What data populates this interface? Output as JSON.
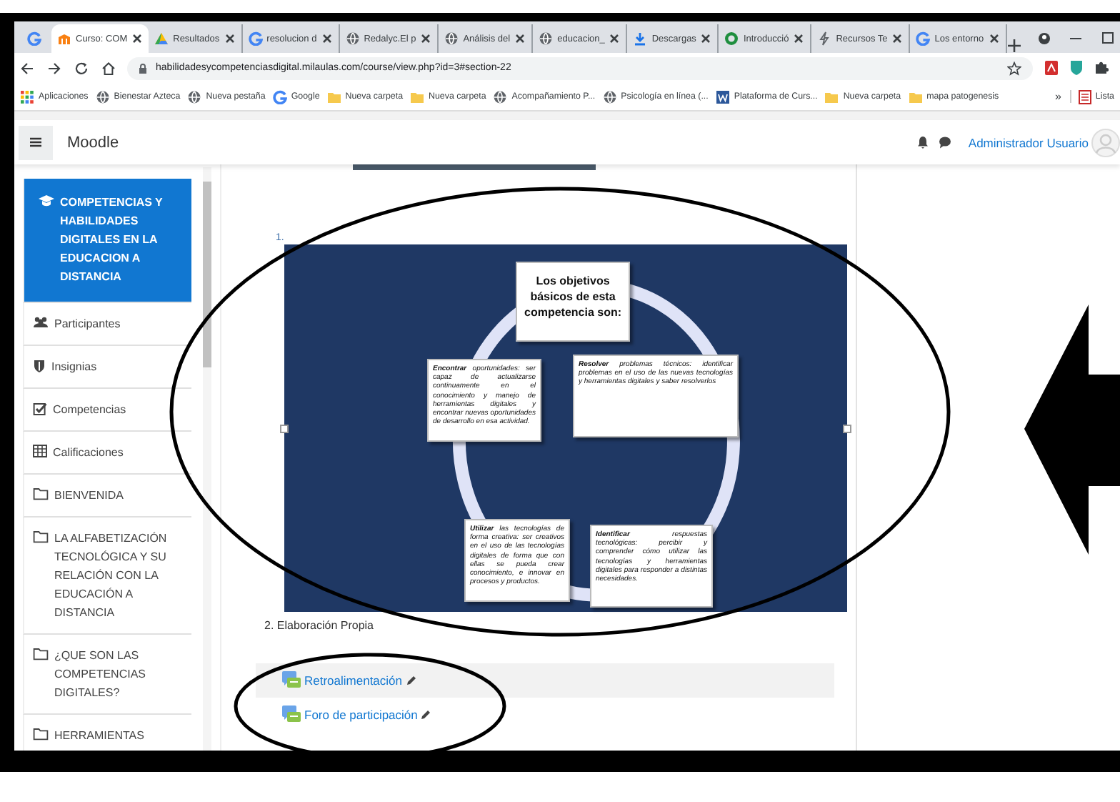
{
  "browser": {
    "tabs": [
      {
        "selected": false
      },
      {
        "label": "Curso: COM",
        "selected": true
      },
      {
        "label": "Resultados",
        "selected": false
      },
      {
        "label": "resolucion d",
        "selected": false
      },
      {
        "label": "Redalyc.El p",
        "selected": false
      },
      {
        "label": "Análisis del",
        "selected": false
      },
      {
        "label": "educacion_",
        "selected": false
      },
      {
        "label": "Descargas",
        "selected": false
      },
      {
        "label": "Introducció",
        "selected": false
      },
      {
        "label": "Recursos Te",
        "selected": false
      },
      {
        "label": "Los entorno",
        "selected": false
      }
    ],
    "url": "habilidadesycompetenciasdigital.milaulas.com/course/view.php?id=3#section-22",
    "bookmarks": [
      "Aplicaciones",
      "Bienestar Azteca",
      "Nueva pestaña",
      "Google",
      "Nueva carpeta",
      "Nueva carpeta",
      "Acompañamiento P...",
      "Psicología en línea (...",
      "Plataforma de Curs...",
      "Nueva carpeta",
      "mapa patogenesis"
    ],
    "bookmarks_overflow": "»",
    "other_bookmarks": "Lista"
  },
  "navbar": {
    "brand": "Moodle",
    "user": "Administrador Usuario"
  },
  "sidebar": {
    "items": [
      {
        "label": "COMPETENCIAS Y HABILIDADES DIGITALES EN LA EDUCACION A DISTANCIA",
        "selected": true
      },
      {
        "label": "Participantes",
        "selected": false
      },
      {
        "label": "Insignias",
        "selected": false
      },
      {
        "label": "Competencias",
        "selected": false
      },
      {
        "label": "Calificaciones",
        "selected": false
      },
      {
        "label": "BIENVENIDA",
        "selected": false
      },
      {
        "label": "LA ALFABETIZACIÓN TECNOLÓGICA Y SU RELACIÓN CON LA EDUCACIÓN A DISTANCIA",
        "selected": false
      },
      {
        "label": "¿QUE SON LAS COMPETENCIAS DIGITALES?",
        "selected": false
      },
      {
        "label": "HERRAMIENTAS",
        "selected": false
      }
    ]
  },
  "content": {
    "figure_number": "1.",
    "diagram": {
      "center": "Los objetivos básicos de esta competencia son:",
      "boxes": [
        {
          "text": "**Encontrar** oportunidades: ser capaz de actualizarse continuamente en el conocimiento y manejo de herramientas digitales y encontrar nuevas oportunidades de desarrollo en esa actividad."
        },
        {
          "text": "**Resolver** problemas técnicos: identificar problemas en el uso de las nuevas tecnologías y herramientas digitales y saber resolverlos"
        },
        {
          "text": "**Utilizar** las tecnologías de forma creativa: ser creativos en el uso de las tecnologías digitales de forma que con ellas se pueda crear conocimiento, e innovar en procesos y productos."
        },
        {
          "text": "**Identificar** respuestas tecnológicas: percibir y comprender cómo utilizar las tecnologías y herramientas digitales para responder a distintas necesidades."
        }
      ]
    },
    "caption": "2. Elaboración Propia",
    "activities": [
      {
        "label": "Retroalimentación",
        "selected": true
      },
      {
        "label": "Foro de participación",
        "selected": false
      }
    ]
  }
}
